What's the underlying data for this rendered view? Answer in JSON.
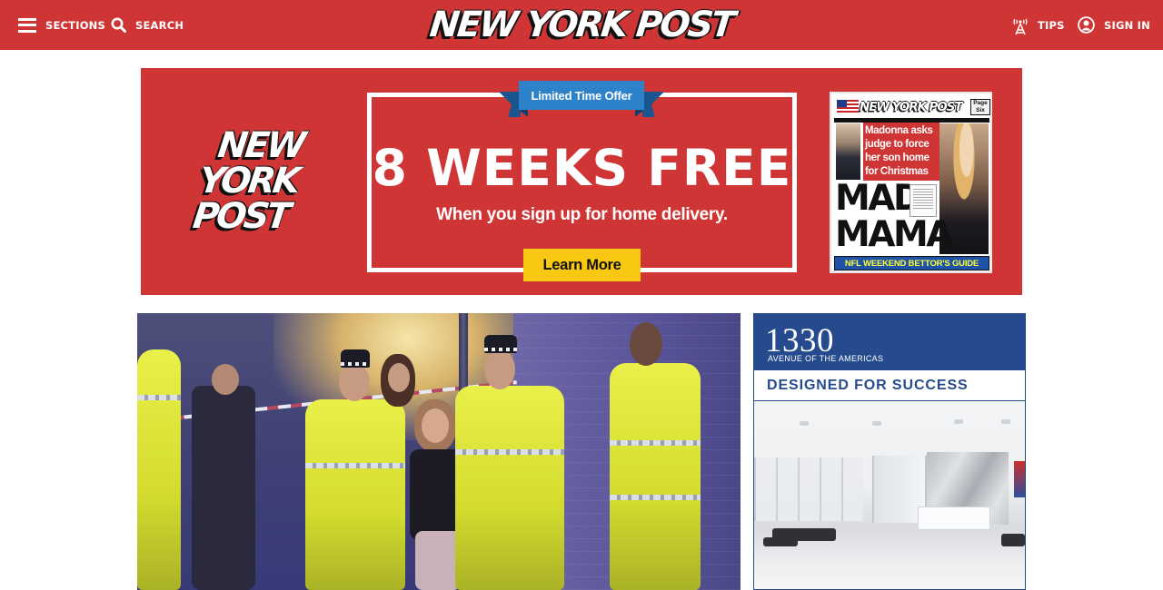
{
  "header": {
    "sections_label": "SECTIONS",
    "search_label": "SEARCH",
    "masthead": "NEW YORK POST",
    "tips_label": "TIPS",
    "signin_label": "SIGN IN"
  },
  "promo": {
    "logo_lines": [
      "NEW",
      "YORK",
      "POST"
    ],
    "ribbon_label": "Limited Time Offer",
    "headline": "8 WEEKS FREE",
    "subheadline": "When you sign up for home delivery.",
    "cta_label": "Learn More",
    "cover": {
      "masthead": "NEW YORK POST",
      "tag": "Page Six",
      "teaser": "Madonna asks judge to force her son home for Christmas",
      "headline_lines": [
        "MAD",
        "MAMA"
      ],
      "footer": "NFL WEEKEND BETTOR'S GUIDE"
    }
  },
  "ad": {
    "number": "1330",
    "subtitle": "AVENUE OF THE AMERICAS",
    "tagline": "DESIGNED FOR SUCCESS"
  },
  "colors": {
    "brand_red": "#cf3535",
    "ribbon_blue": "#2e82c9",
    "cta_yellow": "#f8c813",
    "ad_navy": "#254a8d"
  },
  "icons": {
    "sections": "hamburger-menu-icon",
    "search": "magnifier-icon",
    "tips": "antenna-tower-icon",
    "signin": "user-circle-icon"
  }
}
